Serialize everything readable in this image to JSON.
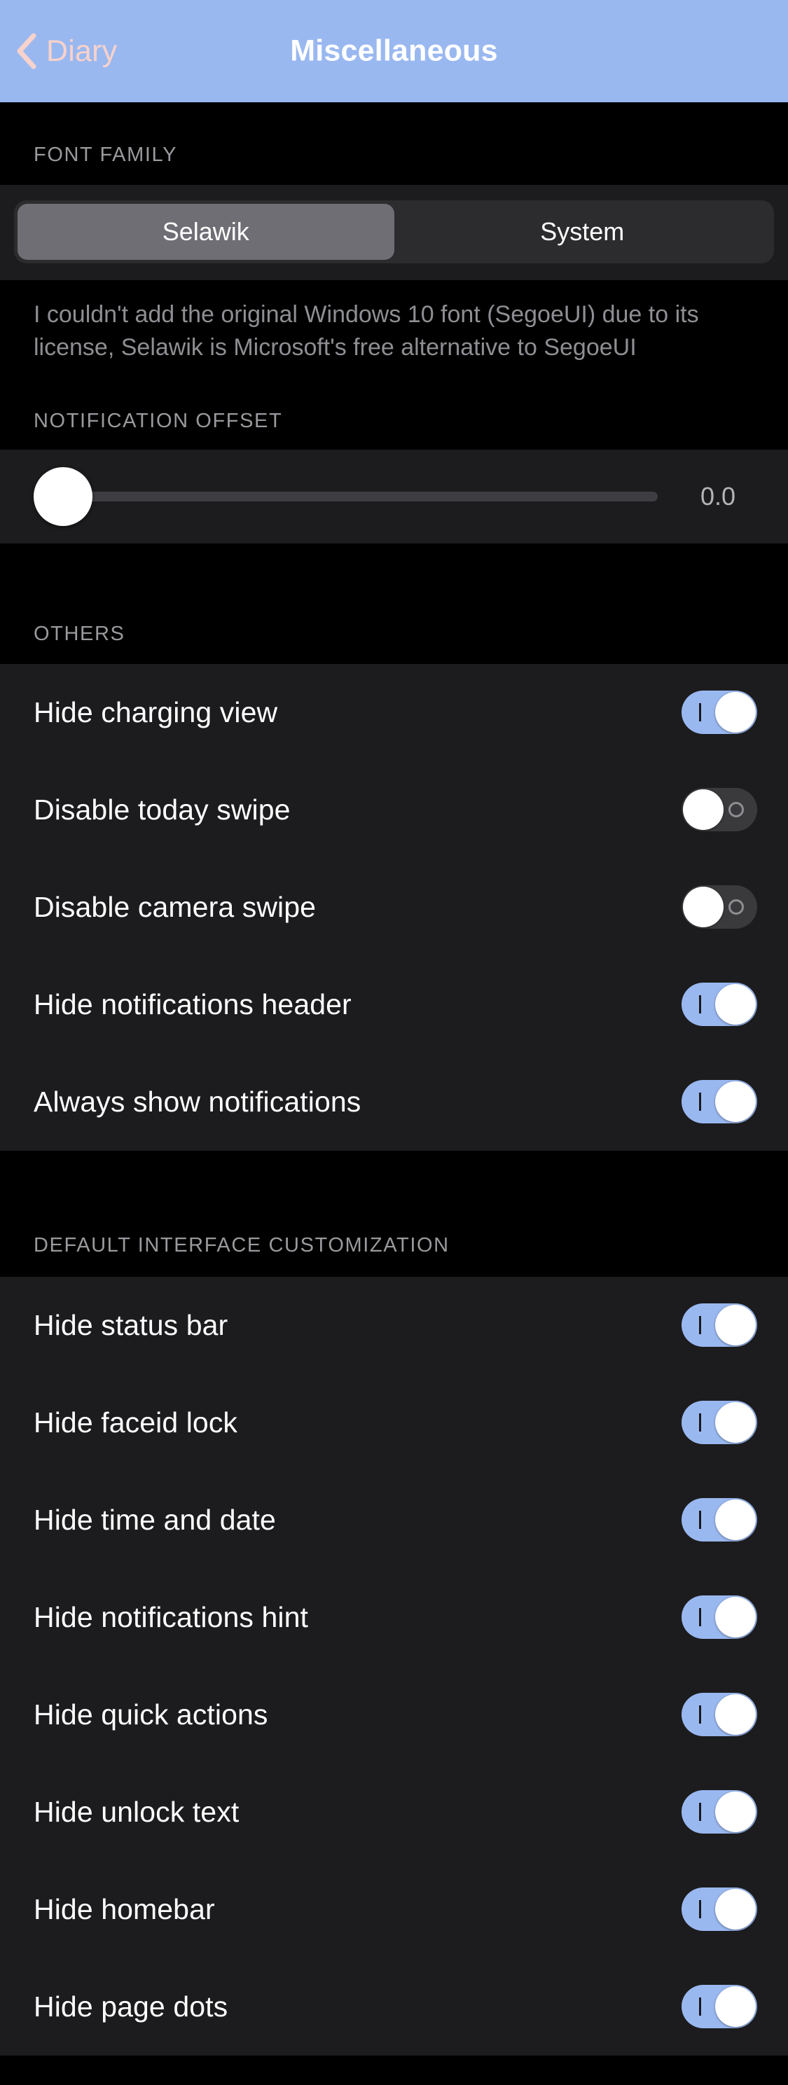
{
  "theme": {
    "accent": "#9ab8f0",
    "back_tint": "#f8d2cc",
    "group_bg": "#1c1c1e",
    "page_bg": "#000000",
    "switch_on": "#9ab8f0",
    "switch_off": "#3a3a3c",
    "header_label": "#9a9a9e"
  },
  "navbar": {
    "back_label": "Diary",
    "back_icon": "chevron-left-icon",
    "title": "Miscellaneous"
  },
  "sections": [
    {
      "id": "font-family",
      "header": "FONT FAMILY",
      "segmented": {
        "options": [
          "Selawik",
          "System"
        ],
        "selected": "Selawik",
        "selected_index": 0
      },
      "description": "I couldn't add the original Windows 10 font (SegoeUI) due to its license, Selawik is Microsoft's free alternative to SegoeUI"
    },
    {
      "id": "notification-offset",
      "header": "NOTIFICATION OFFSET",
      "slider": {
        "value": "0.0",
        "percent": 0,
        "min": "0.0",
        "max": "1.0"
      }
    },
    {
      "id": "others",
      "header": "OTHERS",
      "rows": [
        {
          "label": "Hide charging view",
          "state": "on"
        },
        {
          "label": "Disable today swipe",
          "state": "off"
        },
        {
          "label": "Disable camera swipe",
          "state": "off"
        },
        {
          "label": "Hide notifications header",
          "state": "on"
        },
        {
          "label": "Always show notifications",
          "state": "on"
        }
      ]
    },
    {
      "id": "default-interface-customization",
      "header": "DEFAULT INTERFACE CUSTOMIZATION",
      "rows": [
        {
          "label": "Hide status bar",
          "state": "on"
        },
        {
          "label": "Hide faceid lock",
          "state": "on"
        },
        {
          "label": "Hide time and date",
          "state": "on"
        },
        {
          "label": "Hide notifications hint",
          "state": "on"
        },
        {
          "label": "Hide quick actions",
          "state": "on"
        },
        {
          "label": "Hide unlock text",
          "state": "on"
        },
        {
          "label": "Hide homebar",
          "state": "on"
        },
        {
          "label": "Hide page dots",
          "state": "on"
        }
      ]
    }
  ]
}
